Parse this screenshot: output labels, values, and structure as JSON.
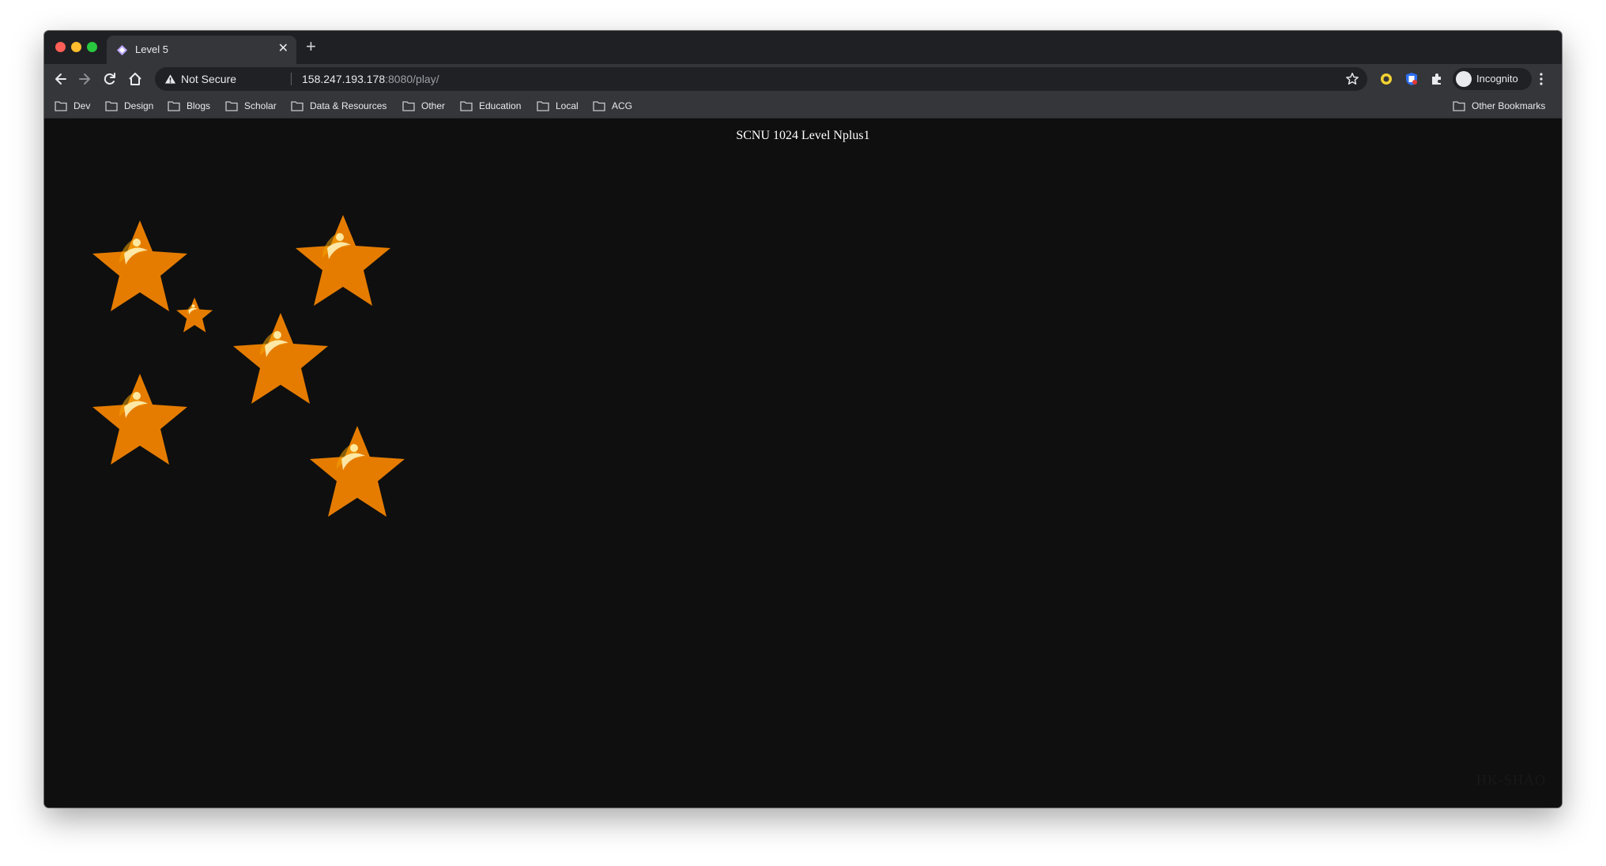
{
  "browser": {
    "tab": {
      "title": "Level 5"
    },
    "address_bar": {
      "security_label": "Not Secure",
      "url_host": "158.247.193.178",
      "url_rest": ":8080/play/"
    },
    "profile": {
      "label": "Incognito"
    },
    "bookmarks": [
      "Dev",
      "Design",
      "Blogs",
      "Scholar",
      "Data & Resources",
      "Other",
      "Education",
      "Local",
      "ACG"
    ],
    "other_bookmarks": "Other Bookmarks"
  },
  "page": {
    "title": "SCNU 1024 Level Nplus1",
    "watermark": "HK-SHAO",
    "star_count": 6
  },
  "colors": {
    "background": "#0f0f0f",
    "star_body": "#ffd21a",
    "star_edge": "#f08c00"
  }
}
